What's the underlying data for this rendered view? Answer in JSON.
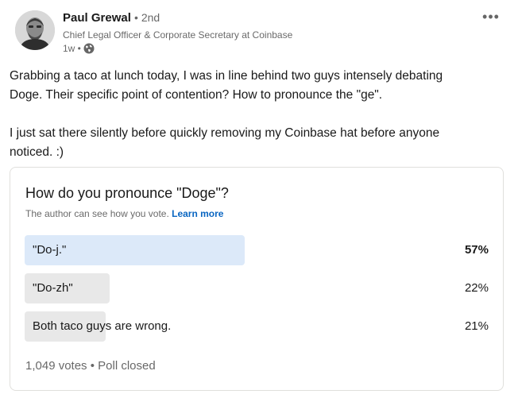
{
  "author": {
    "name": "Paul Grewal",
    "degree": "• 2nd",
    "title": "Chief Legal Officer & Corporate Secretary at Coinbase",
    "time": "1w •"
  },
  "icons": {
    "more": "more-options-icon",
    "visibility": "globe-icon"
  },
  "post": {
    "line1": "Grabbing a taco at lunch today, I was in line behind two guys intensely debating",
    "line2": "Doge. Their specific point of contention? How to pronounce the \"ge\".",
    "line3": "I just sat there silently before quickly removing my Coinbase hat before anyone",
    "line4": "noticed. :)"
  },
  "poll": {
    "question": "How do you pronounce \"Doge\"?",
    "note": "The author can see how you vote.",
    "learn_more": "Learn more",
    "options": [
      {
        "label": "\"Do-j.\"",
        "percent_text": "57%",
        "percent": 57,
        "selected": true
      },
      {
        "label": "\"Do-zh\"",
        "percent_text": "22%",
        "percent": 22,
        "selected": false
      },
      {
        "label": "Both taco guys are wrong.",
        "percent_text": "21%",
        "percent": 21,
        "selected": false
      }
    ],
    "footer": "1,049 votes • Poll closed"
  },
  "colors": {
    "selected_bar": "#dce9f9",
    "bar": "#e8e8e8",
    "link": "#0a66c2"
  }
}
